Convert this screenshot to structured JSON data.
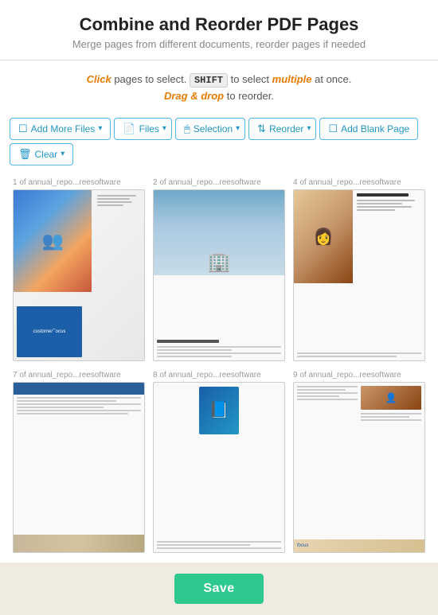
{
  "page": {
    "title": "Combine and Reorder PDF Pages",
    "subtitle": "Merge pages from different documents, reorder pages if needed"
  },
  "instructions": {
    "part1": "Click",
    "part2": "pages to select.",
    "shift": "SHIFT",
    "part3": "to select",
    "multiple": "multiple",
    "part4": "at once.",
    "drag": "Drag & drop",
    "part5": "to reorder."
  },
  "toolbar": {
    "add_files": "Add More Files",
    "files": "Files",
    "selection": "Selection",
    "reorder": "Reorder",
    "add_blank": "Add Blank Page",
    "clear": "Clear"
  },
  "pages": [
    {
      "label": "1 of annual_repo...reesoftware",
      "id": "page-1"
    },
    {
      "label": "2 of annual_repo...reesoftware",
      "id": "page-2"
    },
    {
      "label": "4 of annual_repo...reesoftware",
      "id": "page-4"
    },
    {
      "label": "7 of annual_repo...reesoftware",
      "id": "page-7"
    },
    {
      "label": "8 of annual_repo...reesoftware",
      "id": "page-8"
    },
    {
      "label": "9 of annual_repo...reesoftware",
      "id": "page-9"
    }
  ],
  "footer": {
    "save_label": "Save"
  }
}
